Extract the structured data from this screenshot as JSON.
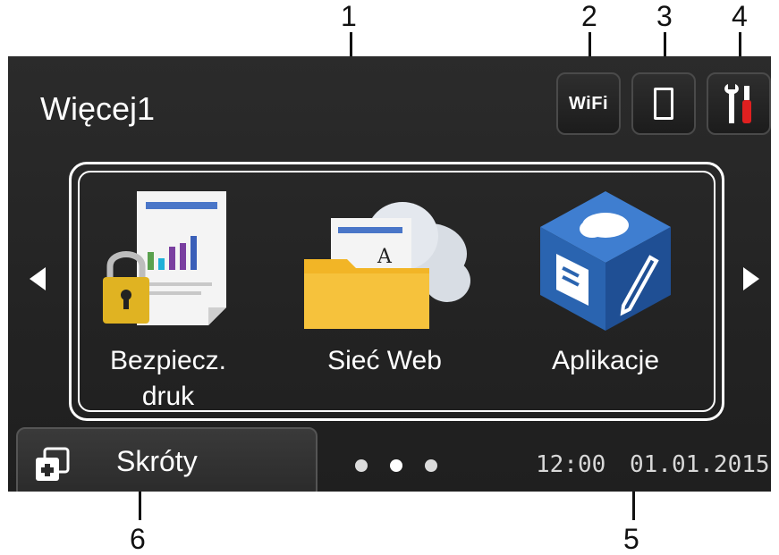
{
  "callouts": [
    "1",
    "2",
    "3",
    "4",
    "5",
    "6"
  ],
  "screen": {
    "title": "Więcej1",
    "status": {
      "wifi_label": "WiFi",
      "device_icon": "toner-icon",
      "settings_icon": "wrench-screwdriver-icon"
    },
    "apps": [
      {
        "label_line1": "Bezpiecz.",
        "label_line2": "druk",
        "icon": "secure-print-icon"
      },
      {
        "label_line1": "Sieć Web",
        "label_line2": "",
        "icon": "web-folder-cloud-icon"
      },
      {
        "label_line1": "Aplikacje",
        "label_line2": "",
        "icon": "apps-cube-icon"
      }
    ],
    "shortcuts_label": "Skróty",
    "page_dots": 3,
    "time": "12:00",
    "date": "01.01.2015"
  },
  "colors": {
    "screen_bg": "#262626",
    "text": "#ffffff",
    "folder": "#f2b526",
    "cube": "#2a64b0",
    "lock": "#e0b322"
  }
}
